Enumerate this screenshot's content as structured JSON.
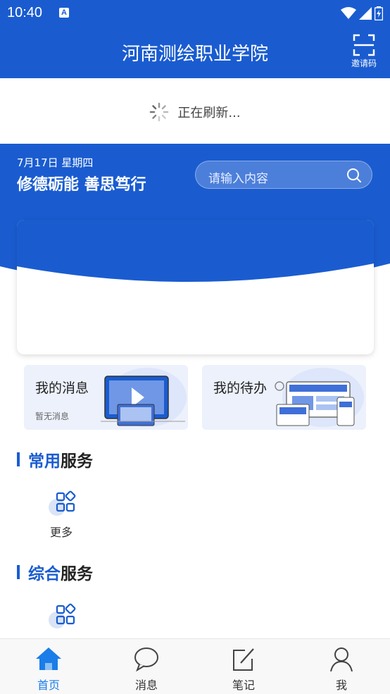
{
  "status_bar": {
    "time": "10:40",
    "app_indicator": "A"
  },
  "header": {
    "title": "河南测绘职业学院",
    "invite_label": "邀请码",
    "invite_icon": "scan-icon"
  },
  "refresh": {
    "text": "正在刷新..."
  },
  "hero": {
    "date": "7月17日 星期四",
    "motto": "修德砺能  善思笃行",
    "search_placeholder": "请输入内容"
  },
  "quick": {
    "messages": {
      "title": "我的消息",
      "subtitle": "暂无消息"
    },
    "todo": {
      "title": "我的待办"
    }
  },
  "sections": {
    "common": {
      "accent": "常用",
      "rest": "服务",
      "items": [
        {
          "label": "更多",
          "icon": "grid-more-icon"
        }
      ]
    },
    "general": {
      "accent": "综合",
      "rest": "服务",
      "items": [
        {
          "label": "",
          "icon": "grid-more-icon"
        }
      ]
    }
  },
  "tabs": [
    {
      "label": "首页",
      "icon": "home-icon",
      "active": true
    },
    {
      "label": "消息",
      "icon": "chat-icon",
      "active": false
    },
    {
      "label": "笔记",
      "icon": "note-icon",
      "active": false
    },
    {
      "label": "我",
      "icon": "user-icon",
      "active": false
    }
  ],
  "colors": {
    "primary": "#1a5cd0",
    "tab_active": "#1a7de8",
    "card_bg": "#ecf1fc"
  }
}
